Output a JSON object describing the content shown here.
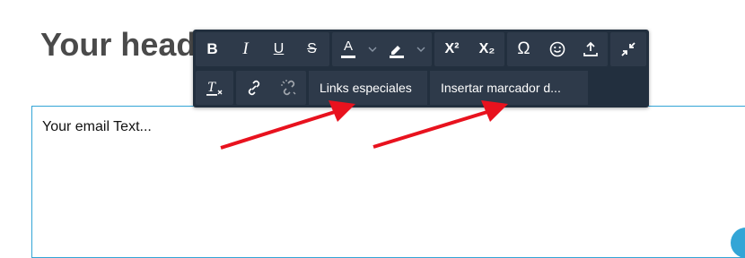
{
  "page": {
    "heading": "Your head",
    "email_text": "Your email Text..."
  },
  "toolbar": {
    "bold_label": "B",
    "italic_label": "I",
    "underline_label": "U",
    "strike_label": "S",
    "font_color_label": "A",
    "superscript_label": "X²",
    "subscript_label": "X₂",
    "special_char_label": "Ω",
    "special_links_label": "Links especiales",
    "insert_bookmark_label": "Insertar marcador d..."
  },
  "icons": [
    "bold-icon",
    "italic-icon",
    "underline-icon",
    "strikethrough-icon",
    "text-color-icon",
    "highlight-color-icon",
    "chevron-down-icon",
    "superscript-icon",
    "subscript-icon",
    "omega-icon",
    "emoticon-icon",
    "upload-icon",
    "collapse-icon",
    "clear-formatting-icon",
    "link-icon",
    "unlink-icon"
  ],
  "colors": {
    "toolbar_bg": "#222f3e",
    "button_bg": "#2e3a4a",
    "editor_border": "#33a5d6",
    "annotation_arrow": "#e8121e"
  }
}
